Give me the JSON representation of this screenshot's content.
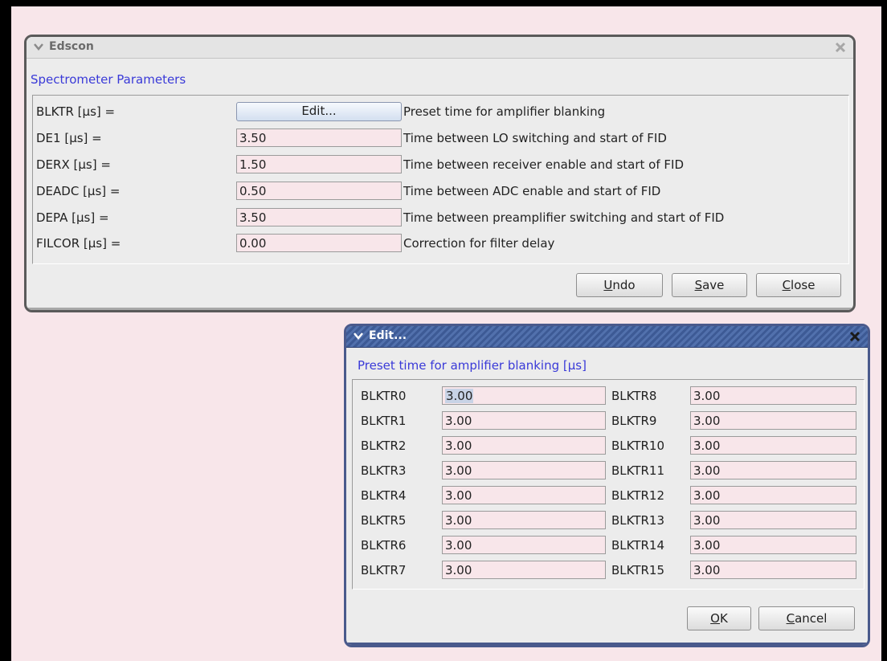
{
  "main_window": {
    "title": "Edscon",
    "section_title": "Spectrometer Parameters",
    "params": [
      {
        "label": "BLKTR [µs] =",
        "value": "",
        "button": "Edit...",
        "description": "Preset time for amplifier blanking"
      },
      {
        "label": "DE1 [µs] =",
        "value": "3.50",
        "description": "Time between LO switching and start of FID"
      },
      {
        "label": "DERX [µs] =",
        "value": "1.50",
        "description": "Time between receiver enable and start of FID"
      },
      {
        "label": "DEADC [µs] =",
        "value": "0.50",
        "description": "Time between ADC enable and start of FID"
      },
      {
        "label": "DEPA [µs] =",
        "value": "3.50",
        "description": "Time between preamplifier switching and start of FID"
      },
      {
        "label": "FILCOR [µs] =",
        "value": "0.00",
        "description": "Correction for filter delay"
      }
    ],
    "buttons": {
      "undo": {
        "mnemonic": "U",
        "rest": "ndo"
      },
      "save": {
        "mnemonic": "S",
        "rest": "ave"
      },
      "close": {
        "mnemonic": "C",
        "rest": "lose"
      }
    }
  },
  "edit_dialog": {
    "title": "Edit...",
    "section_title": "Preset time for amplifier blanking [µs]",
    "left": [
      {
        "label": "BLKTR0",
        "value": "3.00"
      },
      {
        "label": "BLKTR1",
        "value": "3.00"
      },
      {
        "label": "BLKTR2",
        "value": "3.00"
      },
      {
        "label": "BLKTR3",
        "value": "3.00"
      },
      {
        "label": "BLKTR4",
        "value": "3.00"
      },
      {
        "label": "BLKTR5",
        "value": "3.00"
      },
      {
        "label": "BLKTR6",
        "value": "3.00"
      },
      {
        "label": "BLKTR7",
        "value": "3.00"
      }
    ],
    "right": [
      {
        "label": "BLKTR8",
        "value": "3.00"
      },
      {
        "label": "BLKTR9",
        "value": "3.00"
      },
      {
        "label": "BLKTR10",
        "value": "3.00"
      },
      {
        "label": "BLKTR11",
        "value": "3.00"
      },
      {
        "label": "BLKTR12",
        "value": "3.00"
      },
      {
        "label": "BLKTR13",
        "value": "3.00"
      },
      {
        "label": "BLKTR14",
        "value": "3.00"
      },
      {
        "label": "BLKTR15",
        "value": "3.00"
      }
    ],
    "buttons": {
      "ok": {
        "mnemonic": "O",
        "rest": "K"
      },
      "cancel": {
        "mnemonic": "C",
        "rest": "ancel"
      }
    }
  },
  "icons": {
    "menu": "chevron-down-icon",
    "close": "close-icon"
  },
  "colors": {
    "background": "#f8e6ea",
    "section_title": "#3a3ad8",
    "dialog_title_bar": "#3d5a95",
    "field_background": "#f8e6ea"
  }
}
